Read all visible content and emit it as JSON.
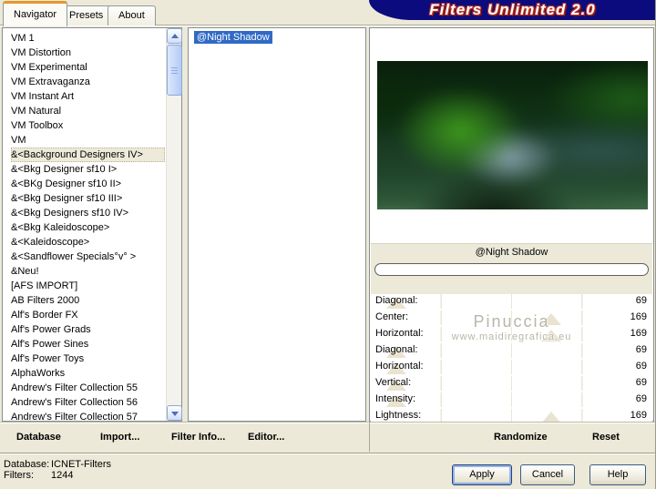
{
  "window": {
    "title": "Filters Unlimited 2.0",
    "tabs": [
      {
        "label": "Navigator",
        "active": true
      },
      {
        "label": "Presets",
        "active": false
      },
      {
        "label": "About",
        "active": false
      }
    ]
  },
  "categories": {
    "selected_index": 8,
    "items": [
      "VM 1",
      "VM Distortion",
      "VM Experimental",
      "VM Extravaganza",
      "VM Instant Art",
      "VM Natural",
      "VM Toolbox",
      "VM",
      "&<Background Designers IV>",
      "&<Bkg Designer sf10 I>",
      "&<BKg Designer sf10 II>",
      "&<Bkg Designer sf10 III>",
      "&<Bkg Designers sf10 IV>",
      "&<Bkg Kaleidoscope>",
      "&<Kaleidoscope>",
      "&<Sandflower Specials°v° >",
      "&Neu!",
      "[AFS IMPORT]",
      "AB Filters 2000",
      "Alf's Border FX",
      "Alf's Power Grads",
      "Alf's Power Sines",
      "Alf's Power Toys",
      "AlphaWorks",
      "Andrew's Filter Collection 55",
      "Andrew's Filter Collection 56",
      "Andrew's Filter Collection 57"
    ]
  },
  "filters": {
    "items": [
      "@Night Shadow"
    ],
    "selected_index": 0
  },
  "preview": {
    "filter_name": "@Night Shadow",
    "watermark": [
      "Pinuccia",
      "www.maidiregrafica.eu"
    ]
  },
  "parameters": [
    {
      "label": "Diagonal:",
      "value": 69
    },
    {
      "label": "Center:",
      "value": 169
    },
    {
      "label": "Horizontal:",
      "value": 169
    },
    {
      "label": "Diagonal:",
      "value": 69
    },
    {
      "label": "Horizontal:",
      "value": 69
    },
    {
      "label": "Vertical:",
      "value": 69
    },
    {
      "label": "Intensity:",
      "value": 69
    },
    {
      "label": "Lightness:",
      "value": 169
    }
  ],
  "command_bar": {
    "database": "Database",
    "import": "Import...",
    "filter_info": "Filter Info...",
    "editor": "Editor...",
    "randomize": "Randomize",
    "reset": "Reset"
  },
  "status": {
    "database_label": "Database:",
    "database_value": "ICNET-Filters",
    "filters_label": "Filters:",
    "filters_value": "1244"
  },
  "actions": {
    "apply": "Apply",
    "cancel": "Cancel",
    "help": "Help"
  },
  "colors": {
    "chrome": "#ECE9D8",
    "banner": "#0C0B7E",
    "selection": "#316AC5",
    "tab_accent": "#E5972D"
  }
}
